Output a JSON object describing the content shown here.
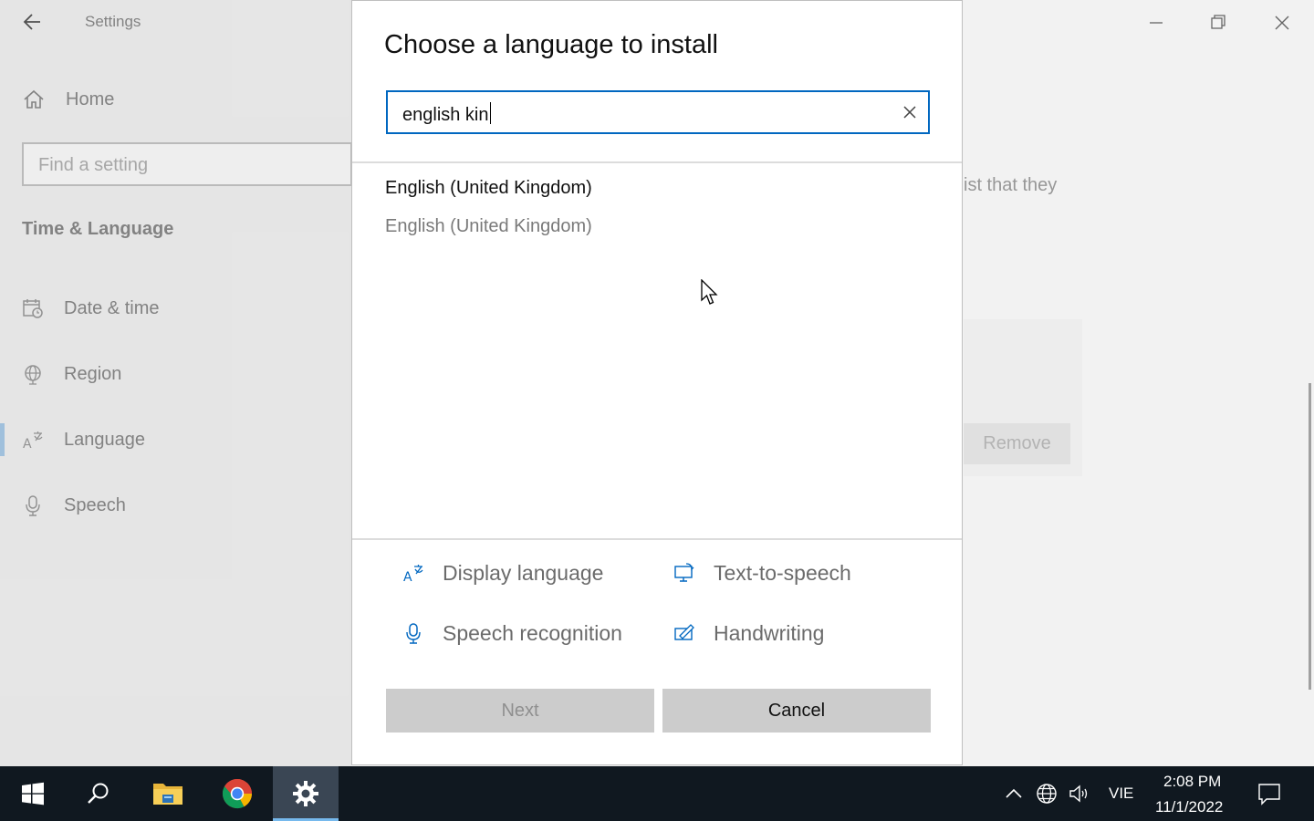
{
  "window": {
    "app_title": "Settings",
    "sidebar": {
      "home_label": "Home",
      "search_placeholder": "Find a setting",
      "section_title": "Time & Language",
      "items": [
        {
          "label": "Date & time",
          "icon": "calendar-clock-icon"
        },
        {
          "label": "Region",
          "icon": "globe-icon"
        },
        {
          "label": "Language",
          "icon": "language-icon",
          "selected": true
        },
        {
          "label": "Speech",
          "icon": "microphone-icon"
        }
      ]
    },
    "background": {
      "partial_text": "ist that they",
      "remove_button": "Remove"
    }
  },
  "dialog": {
    "title": "Choose a language to install",
    "search_value": "english kin",
    "results": [
      {
        "name": "English (United Kingdom)",
        "native_name": "English (United Kingdom)"
      }
    ],
    "features": [
      {
        "label": "Display language",
        "icon": "display-language-icon"
      },
      {
        "label": "Text-to-speech",
        "icon": "text-to-speech-icon"
      },
      {
        "label": "Speech recognition",
        "icon": "microphone-icon"
      },
      {
        "label": "Handwriting",
        "icon": "handwriting-icon"
      }
    ],
    "next_button": "Next",
    "cancel_button": "Cancel"
  },
  "taskbar": {
    "apps": [
      "start-icon",
      "search-icon",
      "file-explorer-icon",
      "chrome-icon",
      "settings-icon"
    ],
    "active_app": "settings-icon",
    "input_language": "VIE",
    "time": "2:08 PM",
    "date": "11/1/2022"
  },
  "colors": {
    "accent": "#0067c0",
    "taskbar": "#101820",
    "selection_bar": "#a9cbe8"
  }
}
